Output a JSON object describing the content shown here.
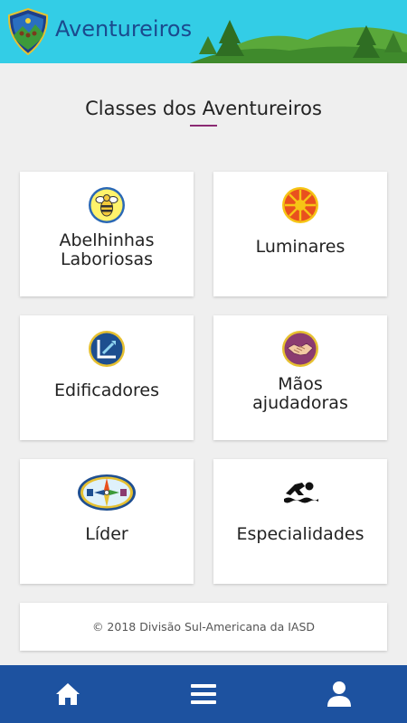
{
  "appbar": {
    "title": "Aventureiros",
    "logo_icon": "adventurers-club-logo",
    "scenery": "mountains-and-pine-trees"
  },
  "section": {
    "title": "Classes dos Aventureiros"
  },
  "cards": [
    {
      "line1": "Abelhinhas",
      "line2": "Laboriosas",
      "icon": "bee-icon"
    },
    {
      "line1": "Luminares",
      "line2": "",
      "icon": "sun-icon"
    },
    {
      "line1": "Edificadores",
      "line2": "",
      "icon": "builders-icon"
    },
    {
      "line1": "Mãos",
      "line2": "ajudadoras",
      "icon": "handshake-icon"
    },
    {
      "line1": "Líder",
      "line2": "",
      "icon": "compass-emblem-icon"
    },
    {
      "line1": "Especialidades",
      "line2": "",
      "icon": "swimmer-icon"
    }
  ],
  "footer": {
    "text": "© 2018 Divisão Sul-Americana da IASD"
  },
  "bottom_nav": [
    {
      "icon": "home-icon"
    },
    {
      "icon": "menu-icon"
    },
    {
      "icon": "user-icon"
    }
  ],
  "colors": {
    "appbar": "#33cde6",
    "title": "#1b4a8e",
    "accent": "#8b2a73",
    "bottom_nav": "#1d52a0"
  }
}
